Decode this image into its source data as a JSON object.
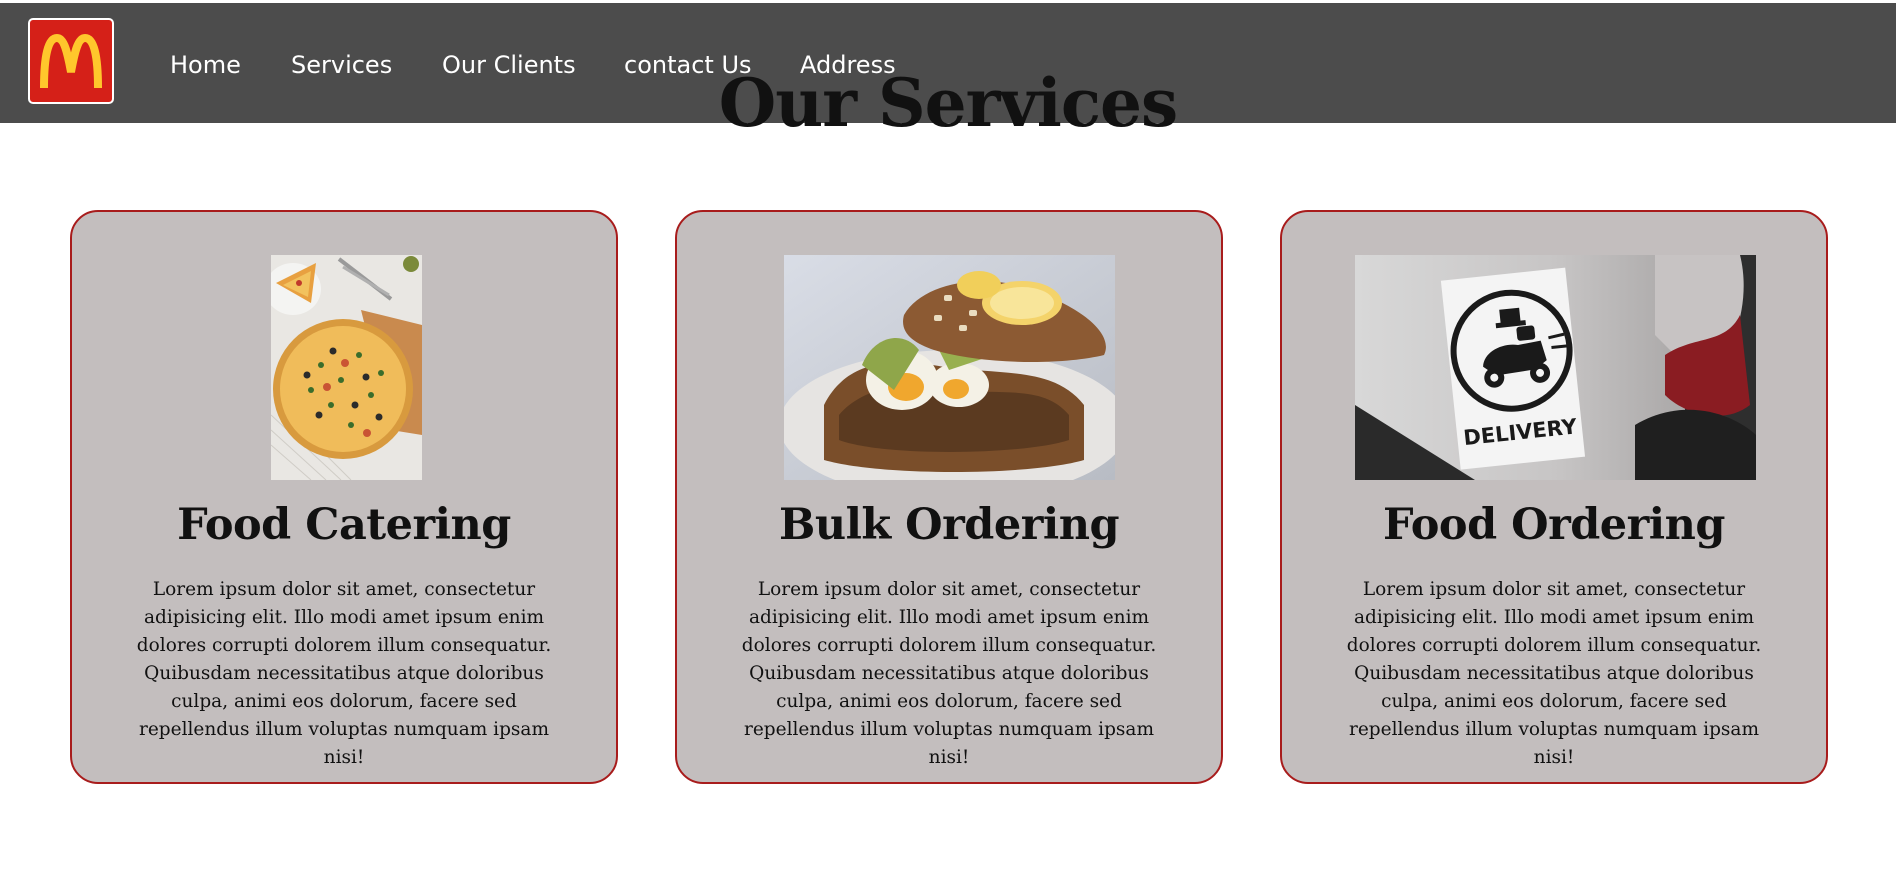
{
  "header": {
    "logo_icon": "mcdonalds-golden-arches-icon",
    "brand_colors": {
      "bar": "#4c4c4c",
      "logo_bg": "#d52018",
      "arches": "#ffc72c"
    },
    "nav": [
      {
        "label": "Home"
      },
      {
        "label": "Services"
      },
      {
        "label": "Our Clients"
      },
      {
        "label": "contact Us"
      },
      {
        "label": "Address"
      }
    ]
  },
  "main": {
    "title": "Our Services",
    "card_colors": {
      "background": "#c3bebe",
      "border": "#a81c1c"
    },
    "cards": [
      {
        "image": "pizza-photo",
        "title": "Food Catering",
        "text": "Lorem ipsum dolor sit amet, consectetur adipisicing elit. Illo modi amet ipsum enim dolores corrupti dolorem illum consequatur. Quibusdam necessitatibus atque doloribus culpa, animi eos dolorum, facere sed repellendus illum voluptas numquam ipsam nisi!"
      },
      {
        "image": "sandwich-photo",
        "title": "Bulk Ordering",
        "text": "Lorem ipsum dolor sit amet, consectetur adipisicing elit. Illo modi amet ipsum enim dolores corrupti dolorem illum consequatur. Quibusdam necessitatibus atque doloribus culpa, animi eos dolorum, facere sed repellendus illum voluptas numquam ipsam nisi!"
      },
      {
        "image": "delivery-photo",
        "image_caption": "DELIVERY",
        "title": "Food Ordering",
        "text": "Lorem ipsum dolor sit amet, consectetur adipisicing elit. Illo modi amet ipsum enim dolores corrupti dolorem illum consequatur. Quibusdam necessitatibus atque doloribus culpa, animi eos dolorum, facere sed repellendus illum voluptas numquam ipsam nisi!"
      }
    ]
  }
}
